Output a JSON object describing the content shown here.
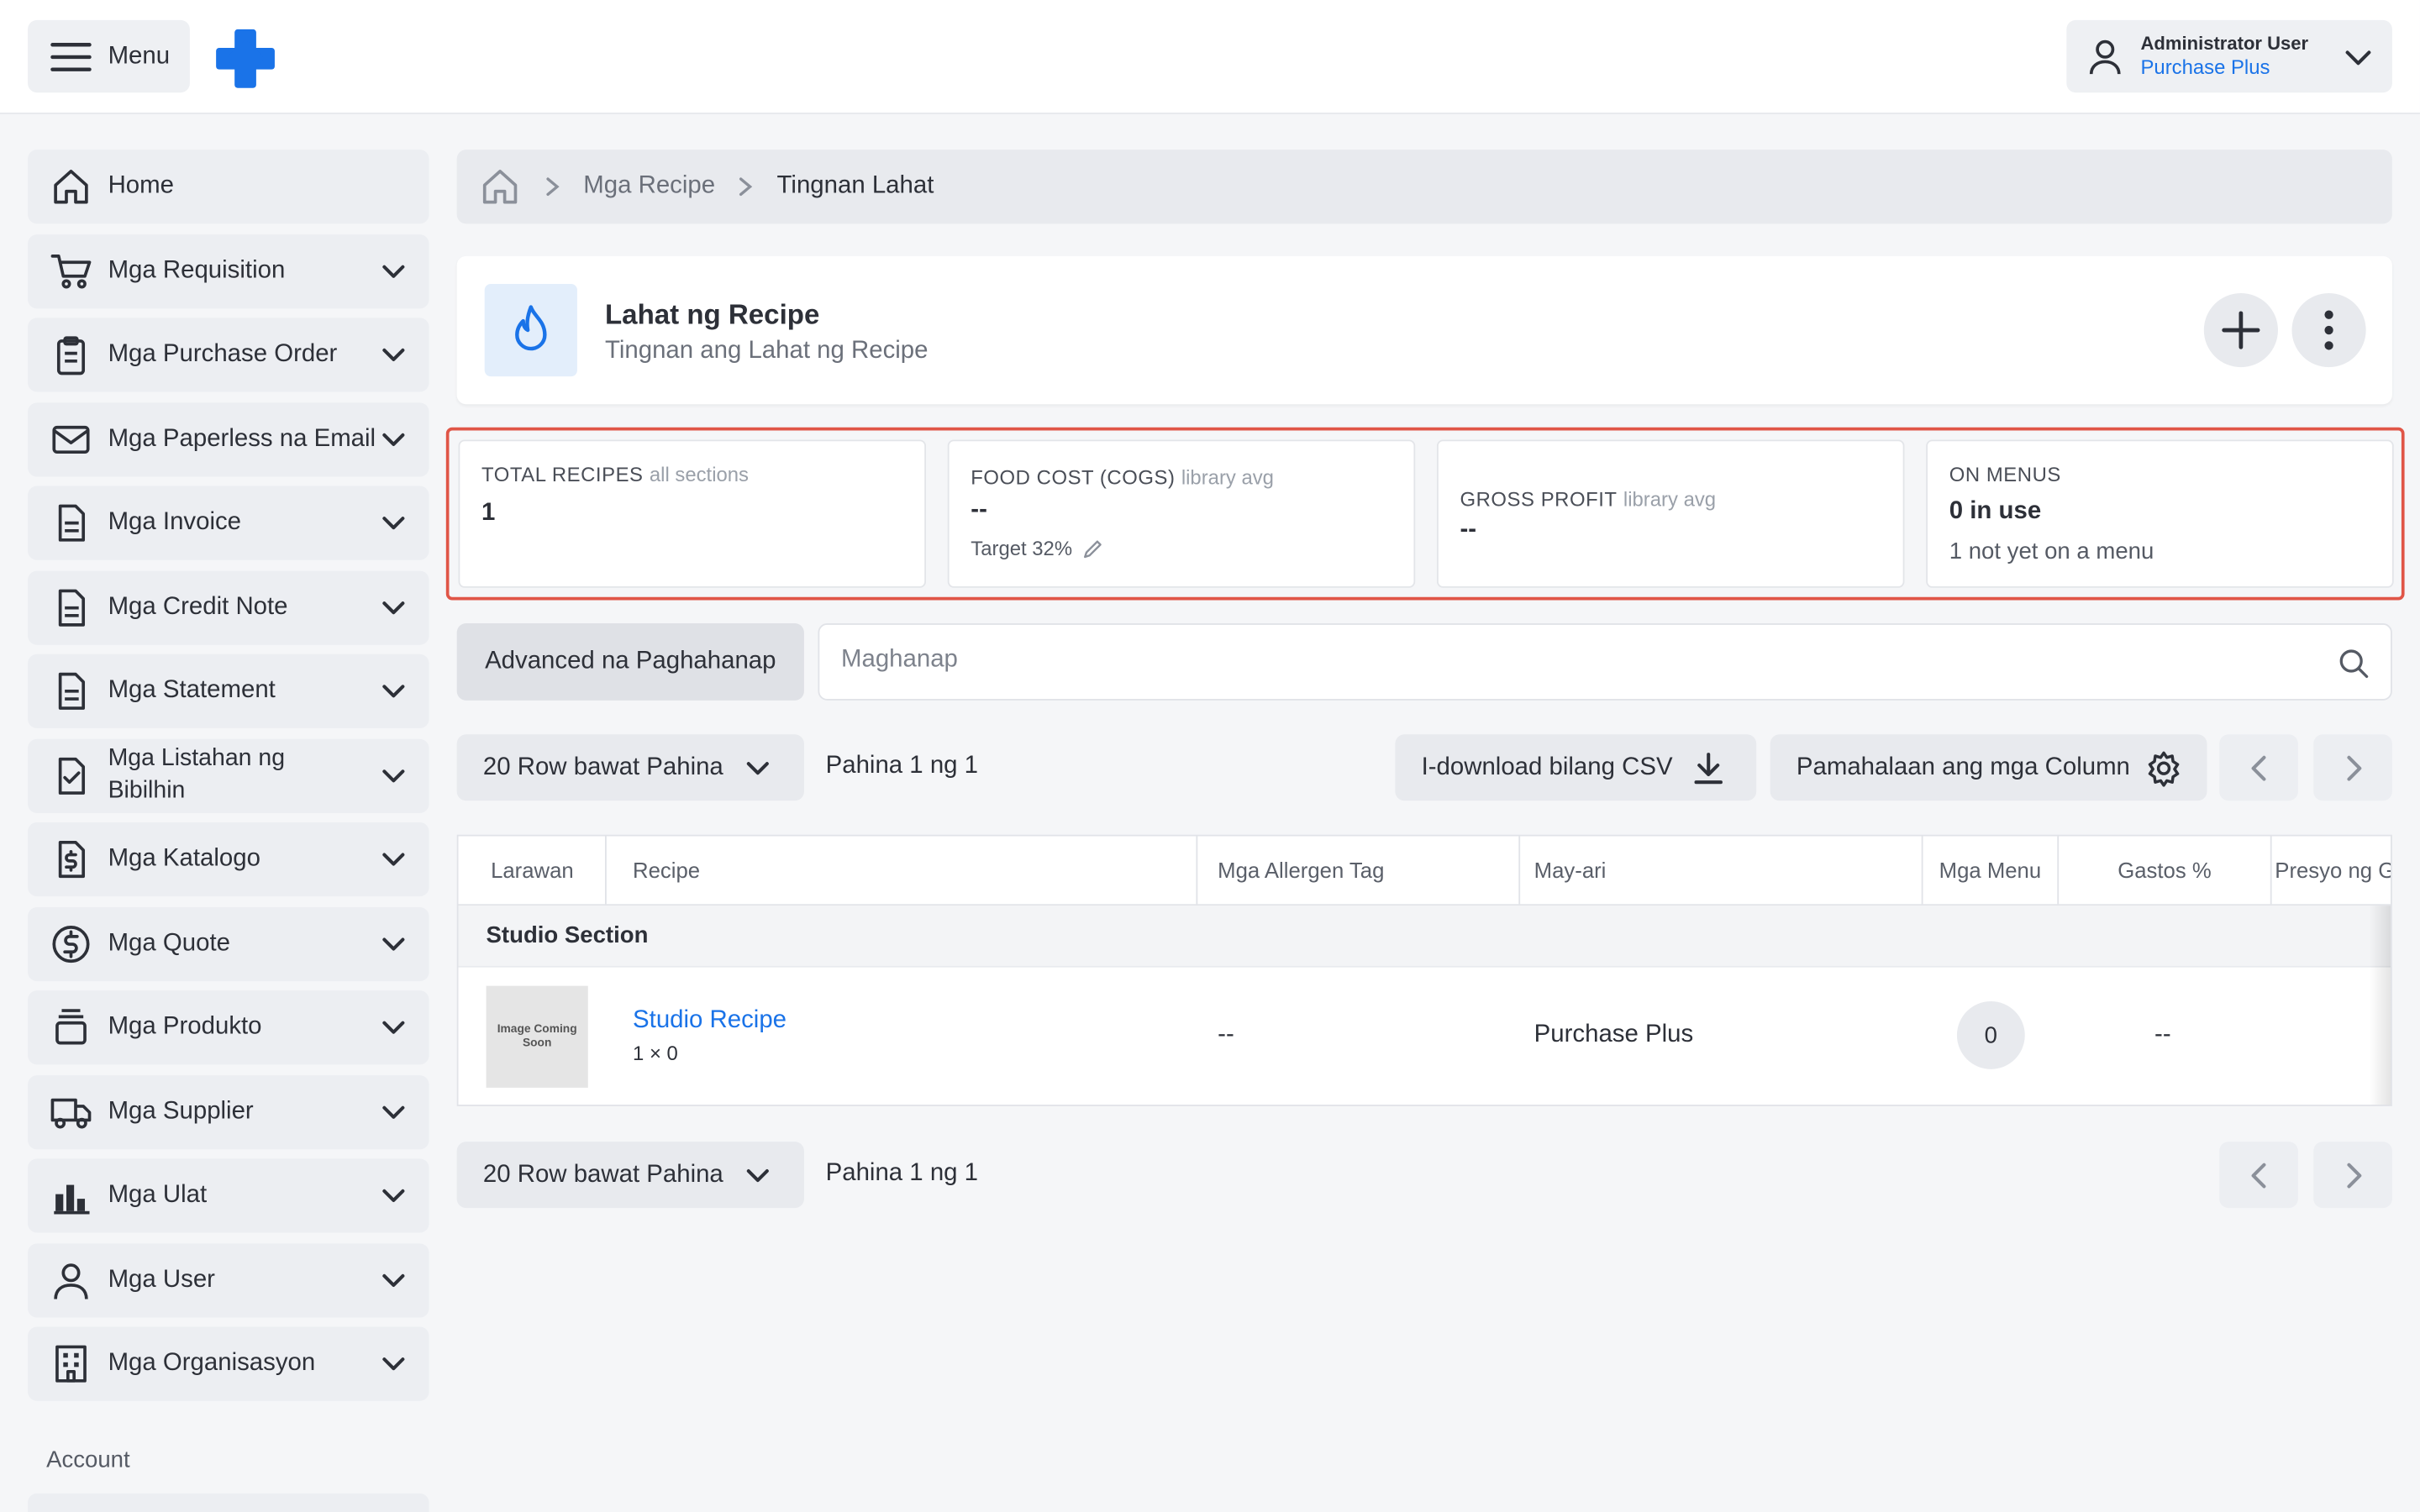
{
  "topbar": {
    "menu_label": "Menu",
    "user_name": "Administrator User",
    "user_org": "Purchase Plus"
  },
  "sidebar": {
    "items": [
      {
        "label": "Home",
        "icon": "home-icon",
        "expandable": false
      },
      {
        "label": "Mga Requisition",
        "icon": "cart-icon",
        "expandable": true
      },
      {
        "label": "Mga Purchase Order",
        "icon": "clipboard-icon",
        "expandable": true
      },
      {
        "label": "Mga Paperless na Email",
        "icon": "mail-icon",
        "expandable": true
      },
      {
        "label": "Mga Invoice",
        "icon": "document-icon",
        "expandable": true
      },
      {
        "label": "Mga Credit Note",
        "icon": "document-icon",
        "expandable": true
      },
      {
        "label": "Mga Statement",
        "icon": "document-icon",
        "expandable": true
      },
      {
        "label": "Mga Listahan ng Bibilhin",
        "icon": "checklist-icon",
        "expandable": true
      },
      {
        "label": "Mga Katalogo",
        "icon": "dollar-document-icon",
        "expandable": true
      },
      {
        "label": "Mga Quote",
        "icon": "dollar-circle-icon",
        "expandable": true
      },
      {
        "label": "Mga Produkto",
        "icon": "product-icon",
        "expandable": true
      },
      {
        "label": "Mga Supplier",
        "icon": "truck-icon",
        "expandable": true
      },
      {
        "label": "Mga Ulat",
        "icon": "bar-chart-icon",
        "expandable": true
      },
      {
        "label": "Mga User",
        "icon": "user-icon",
        "expandable": true
      },
      {
        "label": "Mga Organisasyon",
        "icon": "building-icon",
        "expandable": true
      }
    ],
    "account_label": "Account"
  },
  "breadcrumb": {
    "level1": "Mga Recipe",
    "level2": "Tingnan Lahat"
  },
  "header": {
    "title": "Lahat ng Recipe",
    "subtitle": "Tingnan ang Lahat ng Recipe"
  },
  "stats": {
    "total_recipes": {
      "caption": "TOTAL RECIPES",
      "qualifier": "all sections",
      "value": "1"
    },
    "food_cost": {
      "caption": "FOOD COST (COGS)",
      "qualifier": "library avg",
      "value": "--",
      "target": "Target 32%"
    },
    "gross_profit": {
      "caption": "GROSS PROFIT",
      "qualifier": "library avg",
      "value": "--"
    },
    "on_menus": {
      "caption": "ON MENUS",
      "value": "0 in use",
      "sub": "1 not yet on a menu"
    }
  },
  "search": {
    "advanced_label": "Advanced na Paghahanap",
    "placeholder": "Maghanap"
  },
  "pagination": {
    "rows_per_page": "20 Row bawat Pahina",
    "page_text": "Pahina 1 ng 1",
    "csv_label": "I-download bilang CSV",
    "columns_label": "Pamahalaan ang mga Column"
  },
  "table": {
    "columns": [
      "Larawan",
      "Recipe",
      "Mga Allergen Tag",
      "May-ari",
      "Mga Menu",
      "Gastos %",
      "Presyo ng Ga"
    ],
    "section_title": "Studio Section",
    "rows": [
      {
        "image_text": "Image Coming Soon",
        "recipe": "Studio Recipe",
        "recipe_sub": "1 × 0",
        "allergens": "--",
        "owner": "Purchase Plus",
        "menus": "0",
        "cost_pct": "--"
      }
    ]
  },
  "colors": {
    "accent": "#1a73e8",
    "highlight": "#e05547"
  }
}
